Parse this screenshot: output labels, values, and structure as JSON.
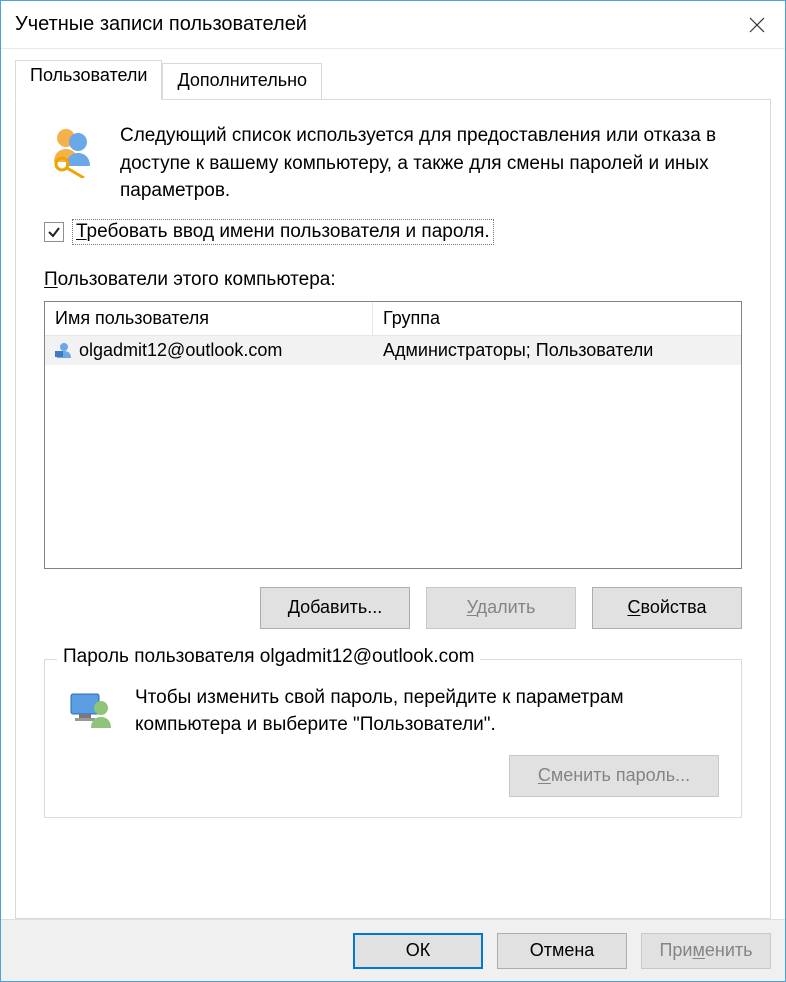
{
  "window": {
    "title": "Учетные записи пользователей"
  },
  "tabs": {
    "users": "Пользователи",
    "advanced": "Дополнительно"
  },
  "intro": "Следующий список используется для предоставления или отказа в доступе к вашему компьютеру, а также для смены паролей и иных параметров.",
  "require_login": {
    "checked": true,
    "label_pre": "Т",
    "label_rest": "ребовать ввод имени пользователя и пароля."
  },
  "list": {
    "label_pre": "П",
    "label_rest": "ользователи этого компьютера:",
    "headers": {
      "name": "Имя пользователя",
      "group": "Группа"
    },
    "rows": [
      {
        "name": "olgadmit12@outlook.com",
        "group": "Администраторы; Пользователи"
      }
    ]
  },
  "buttons": {
    "add_pre": "Д",
    "add_rest": "обавить...",
    "remove_pre": "У",
    "remove_rest": "далить",
    "props_pre": "С",
    "props_rest": "войства"
  },
  "password_group": {
    "legend": "Пароль пользователя olgadmit12@outlook.com",
    "text": "Чтобы изменить свой пароль, перейдите к параметрам компьютера и выберите \"Пользователи\".",
    "button_pre": "С",
    "button_rest": "менить пароль..."
  },
  "footer": {
    "ok": "ОК",
    "cancel": "Отмена",
    "apply_pre": "При",
    "apply_u": "м",
    "apply_rest": "енить"
  }
}
